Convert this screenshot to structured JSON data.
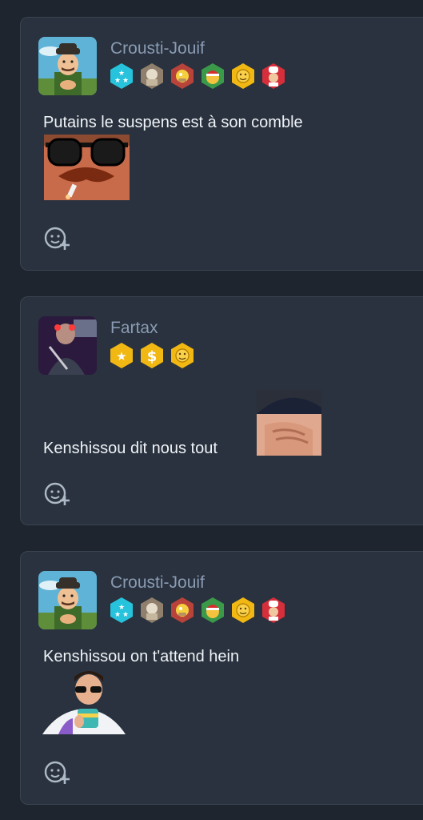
{
  "posts": [
    {
      "username": "Crousti-Jouif",
      "message": "Putains le suspens est à son comble",
      "badges": [
        "tri-star-badge-icon",
        "elder-badge-icon",
        "homer-badge-icon",
        "santa-smiley-badge-icon",
        "hands-smiley-badge-icon",
        "chef-badge-icon"
      ],
      "sticker": "mustache-sunglasses-sticker"
    },
    {
      "username": "Fartax",
      "message": "Kenshissou dit nous tout",
      "badges": [
        "star-badge-icon",
        "dollar-badge-icon",
        "hands-smiley-badge-icon"
      ],
      "sticker": "facepalm-beanie-sticker"
    },
    {
      "username": "Crousti-Jouif",
      "message": "Kenshissou on t'attend hein",
      "badges": [
        "tri-star-badge-icon",
        "elder-badge-icon",
        "homer-badge-icon",
        "santa-smiley-badge-icon",
        "hands-smiley-badge-icon",
        "chef-badge-icon"
      ],
      "sticker": "sunglasses-mug-sticker"
    }
  ],
  "colors": {
    "background": "#1e252e",
    "card": "#29323e",
    "username": "#8a9bb3",
    "text": "#f0f3f7"
  }
}
